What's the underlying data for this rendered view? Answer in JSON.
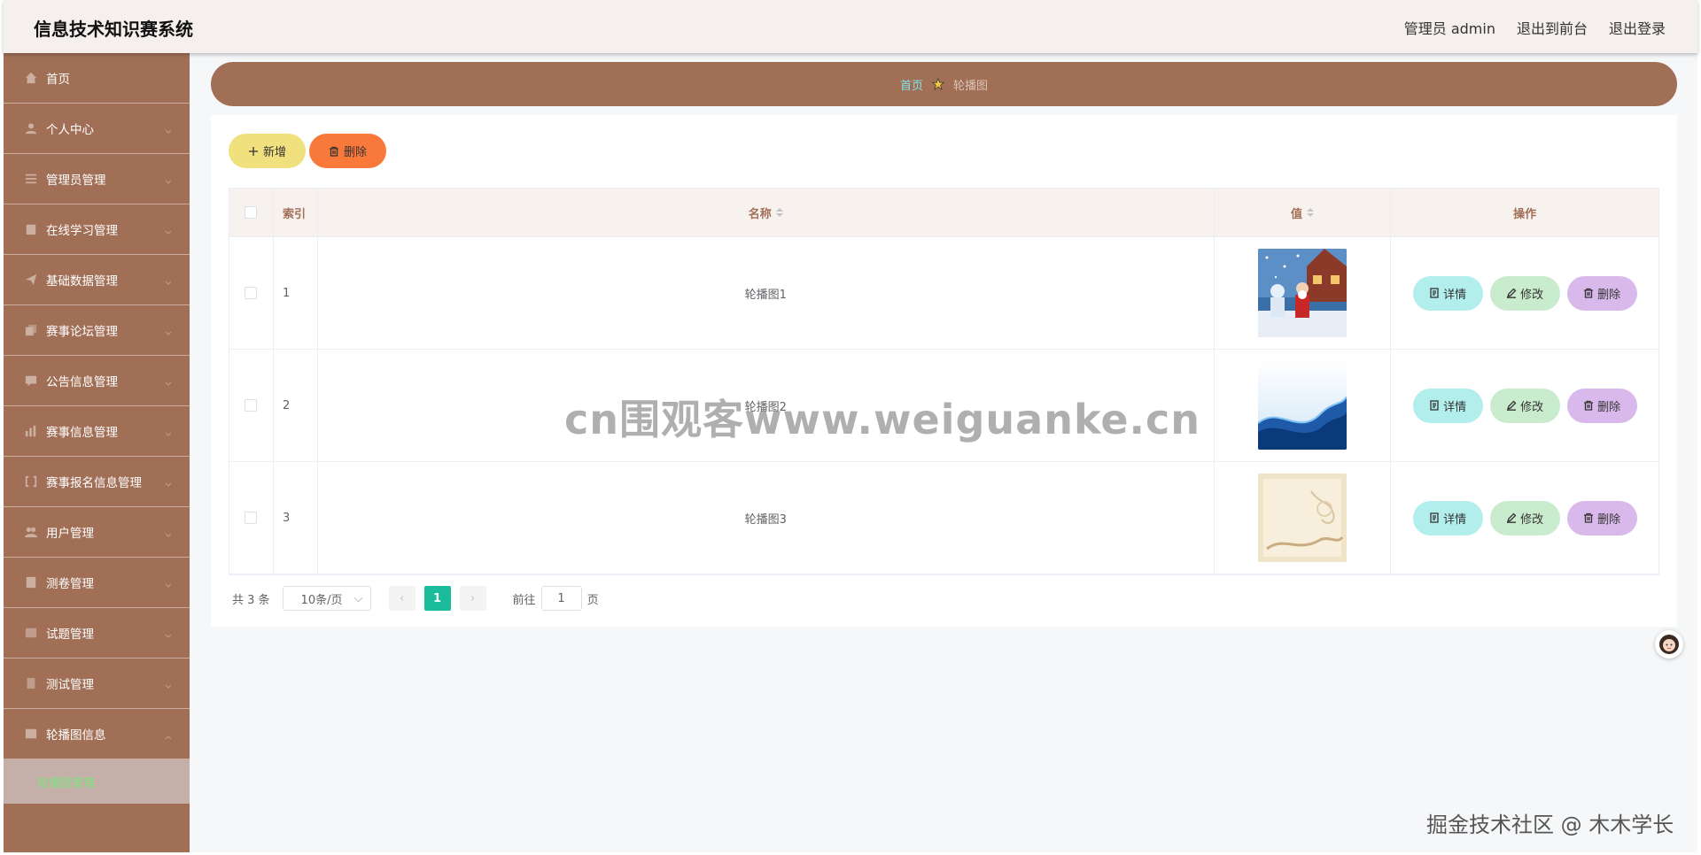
{
  "header": {
    "title": "信息技术知识赛系统",
    "user": "管理员 admin",
    "front": "退出到前台",
    "logout": "退出登录"
  },
  "sidebar": {
    "items": [
      {
        "label": "首页",
        "icon": "home-icon"
      },
      {
        "label": "个人中心",
        "icon": "user-icon"
      },
      {
        "label": "管理员管理",
        "icon": "list-icon"
      },
      {
        "label": "在线学习管理",
        "icon": "clipboard-icon"
      },
      {
        "label": "基础数据管理",
        "icon": "send-icon"
      },
      {
        "label": "赛事论坛管理",
        "icon": "copy-icon"
      },
      {
        "label": "公告信息管理",
        "icon": "message-icon"
      },
      {
        "label": "赛事信息管理",
        "icon": "chart-icon"
      },
      {
        "label": "赛事报名信息管理",
        "icon": "frame-icon"
      },
      {
        "label": "用户管理",
        "icon": "user-group-icon"
      },
      {
        "label": "测卷管理",
        "icon": "paper-icon"
      },
      {
        "label": "试题管理",
        "icon": "question-icon"
      },
      {
        "label": "测试管理",
        "icon": "test-icon"
      },
      {
        "label": "轮播图信息",
        "icon": "image-icon"
      }
    ],
    "submenu": {
      "label": "轮播图管理"
    }
  },
  "breadcrumb": {
    "home": "首页",
    "current": "轮播图"
  },
  "toolbar": {
    "add_label": "新增",
    "delete_label": "删除"
  },
  "table": {
    "headers": {
      "index": "索引",
      "name": "名称",
      "value": "值",
      "ops": "操作"
    },
    "rows": [
      {
        "index": "1",
        "name": "轮播图1",
        "image": "santa-snow-scene"
      },
      {
        "index": "2",
        "name": "轮播图2",
        "image": "blue-wave"
      },
      {
        "index": "3",
        "name": "轮播图3",
        "image": "cream-floral"
      }
    ],
    "ops": {
      "detail": "详情",
      "edit": "修改",
      "delete": "删除"
    }
  },
  "pagination": {
    "total": "共 3 条",
    "page_size": "10条/页",
    "current": "1",
    "goto_prefix": "前往",
    "goto_value": "1",
    "goto_suffix": "页"
  },
  "overlay": {
    "watermark": "cn围观客www.weiguanke.cn",
    "credit": "掘金技术社区 @ 木木学长"
  },
  "colors": {
    "sidebar": "#a16f56",
    "header": "#f5efed",
    "add_button": "#f0e17e",
    "delete_button": "#f9793b",
    "detail_button": "#b2eeeb",
    "edit_button": "#c9ebce",
    "row_delete_button": "#d9b9eb",
    "page_active": "#1abc9c"
  }
}
